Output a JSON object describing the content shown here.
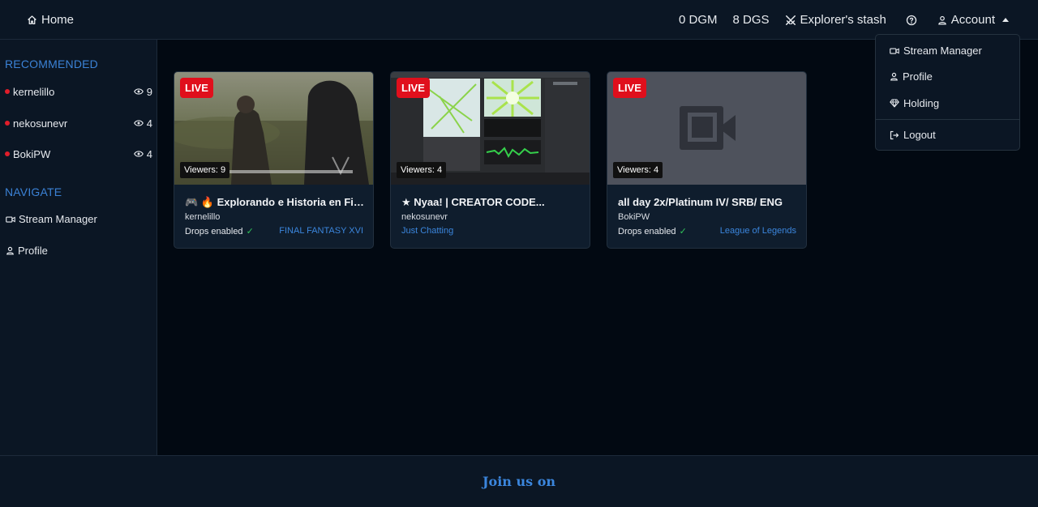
{
  "header": {
    "home_label": "Home",
    "dgm": "0 DGM",
    "dgs": "8 DGS",
    "stash_label": "Explorer's stash",
    "help_icon": "question-icon",
    "account_label": "Account"
  },
  "sidebar": {
    "recommended_heading": "RECOMMENDED",
    "recommended": [
      {
        "name": "kernelillo",
        "viewers": "9"
      },
      {
        "name": "nekosunevr",
        "viewers": "4"
      },
      {
        "name": "BokiPW",
        "viewers": "4"
      }
    ],
    "navigate_heading": "NAVIGATE",
    "navigate": [
      {
        "label": "Stream Manager",
        "icon": "video-camera-icon"
      },
      {
        "label": "Profile",
        "icon": "user-icon"
      }
    ]
  },
  "streams": [
    {
      "live": "LIVE",
      "viewers": "Viewers: 9",
      "title": "🎮 🔥 Explorando e Historia en Final Fantasy XVI",
      "user": "kernelillo",
      "drops": "Drops enabled",
      "game": "FINAL FANTASY XVI"
    },
    {
      "live": "LIVE",
      "viewers": "Viewers: 4",
      "title": "★ Nyaa! | CREATOR CODE...",
      "user": "nekosunevr",
      "game": "Just Chatting"
    },
    {
      "live": "LIVE",
      "viewers": "Viewers: 4",
      "title": "all day 2x/Platinum IV/ SRB/ ENG",
      "user": "BokiPW",
      "drops": "Drops enabled",
      "game": "League of Legends"
    }
  ],
  "account_menu": {
    "items": [
      {
        "label": "Stream Manager",
        "icon": "video-camera-icon"
      },
      {
        "label": "Profile",
        "icon": "user-icon"
      },
      {
        "label": "Holding",
        "icon": "diamond-icon"
      }
    ],
    "logout_label": "Logout"
  },
  "footer": {
    "join_label": "Join us on"
  },
  "colors": {
    "accent": "#3b86dd",
    "live": "#e00f1c",
    "check": "#31c45a",
    "background": "#020912",
    "panel": "#0b1624"
  }
}
